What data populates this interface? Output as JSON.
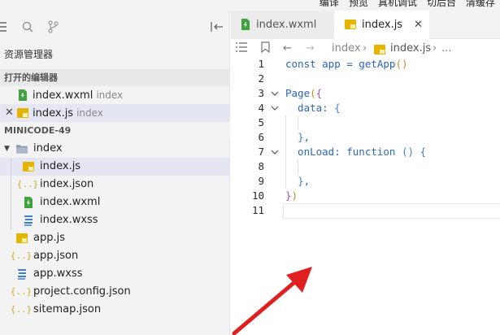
{
  "menu": [
    "编译",
    "预览",
    "真机调试",
    "切后台",
    "清缓存"
  ],
  "sidebar": {
    "title": "资源管理器",
    "open_editors_header": "打开的编辑器",
    "open_editors": [
      {
        "name": "index.wxml",
        "dir": "index",
        "type": "wxml"
      },
      {
        "name": "index.js",
        "dir": "index",
        "type": "js"
      }
    ],
    "project_header": "MINICODE-49",
    "tree": [
      {
        "name": "index",
        "type": "folder"
      },
      {
        "name": "index.js",
        "type": "js"
      },
      {
        "name": "index.json",
        "type": "json"
      },
      {
        "name": "index.wxml",
        "type": "wxml"
      },
      {
        "name": "index.wxss",
        "type": "wxss"
      },
      {
        "name": "app.js",
        "type": "js"
      },
      {
        "name": "app.json",
        "type": "json"
      },
      {
        "name": "app.wxss",
        "type": "wxss"
      },
      {
        "name": "project.config.json",
        "type": "json"
      },
      {
        "name": "sitemap.json",
        "type": "json"
      }
    ]
  },
  "tabs": [
    {
      "name": "index.wxml",
      "type": "wxml"
    },
    {
      "name": "index.js",
      "type": "js"
    }
  ],
  "breadcrumb": {
    "folder": "index",
    "file": "index.js",
    "more": "..."
  },
  "editor": {
    "line_numbers": [
      "1",
      "2",
      "3",
      "4",
      "5",
      "6",
      "7",
      "8",
      "9",
      "10",
      "11"
    ],
    "code_tokens": {
      "l1_const": "const app = getApp",
      "l1_parens": "()",
      "l3_page": "Page",
      "l3_paren": "(",
      "l3_brace": "{",
      "l4_data": "  data: ",
      "l4_brace": "{",
      "l6_brace": "}",
      "l6_comma": ",",
      "l7_onload": "  onLoad: function ",
      "l7_parens": "()",
      "l7_brace": "{",
      "l9_brace": "}",
      "l9_comma": ",",
      "l10_brace": "}",
      "l10_paren": ")"
    }
  },
  "colors": {
    "accent_code": "#2a64b8",
    "file_js": "#e5b300",
    "file_wxml": "#3fa440",
    "file_wxss": "#3a7fd5",
    "file_json": "#d3a92a",
    "arrow": "#e02020"
  }
}
